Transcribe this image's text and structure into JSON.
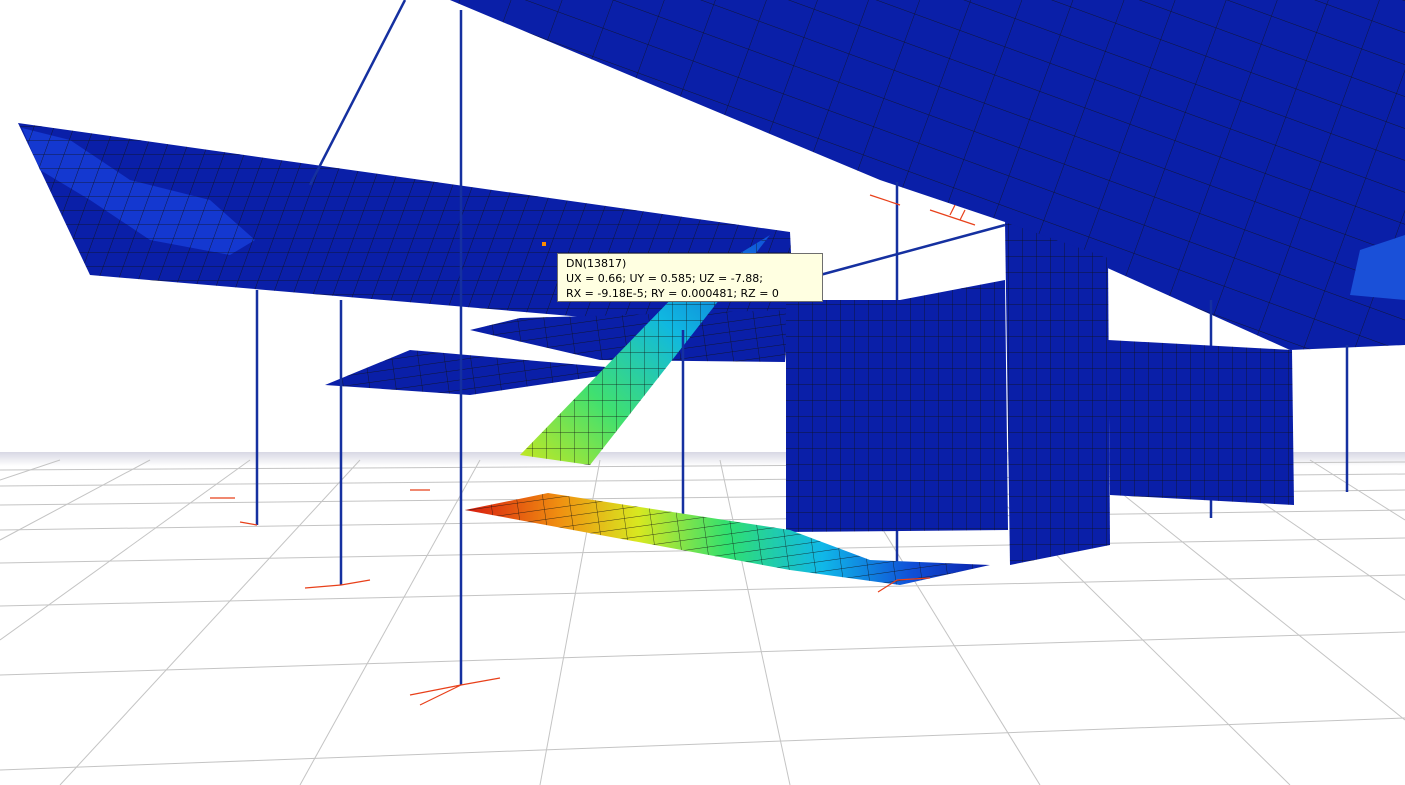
{
  "viewport": {
    "view": "3d-structural-model",
    "result_type": "displacement-contour",
    "colors": {
      "background": "#ffffff",
      "ground_grid": "#b8b8b8",
      "shell_low": "#0a1fa8",
      "mesh_lines": "#1a1a1a",
      "column": "#1530a0",
      "support_symbol": "#e8401a",
      "contour_scale": [
        "#0a1fa8",
        "#1060e0",
        "#10c0e0",
        "#30e080",
        "#c0e020",
        "#f0a010",
        "#e02010"
      ]
    }
  },
  "tooltip": {
    "node_label": "DN(13817)",
    "line1": "UX = 0.66; UY = 0.585; UZ = -7.88;",
    "line2": "RX = -9.18E-5; RY = 0.000481; RZ = 0"
  }
}
